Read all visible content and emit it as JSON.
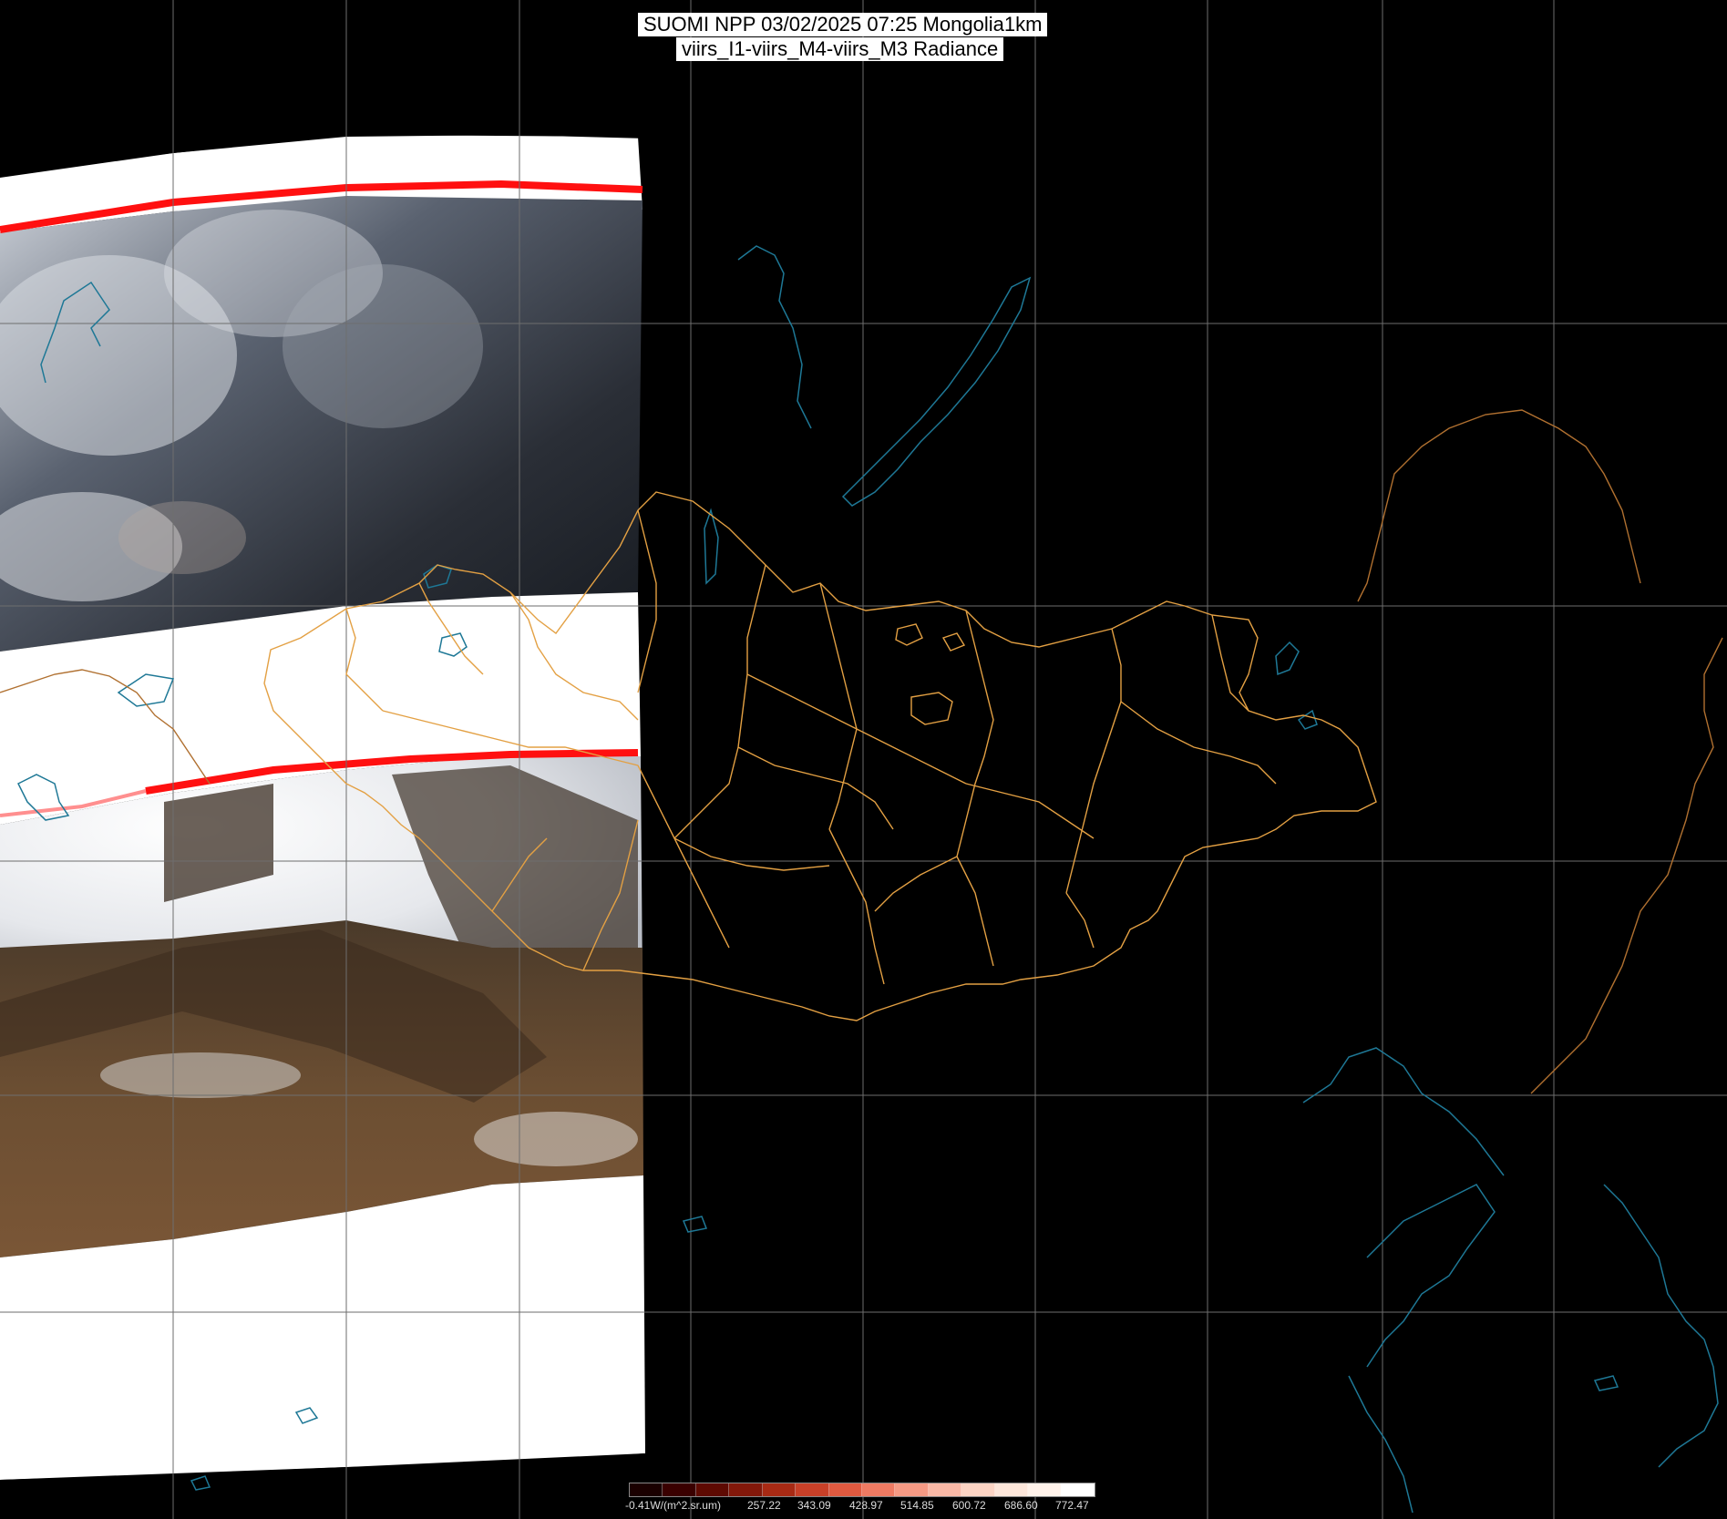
{
  "title": {
    "line1": "SUOMI NPP 03/02/2025 07:25 Mongolia1km",
    "line2": "viirs_I1-viirs_M4-viirs_M3 Radiance"
  },
  "colorbar": {
    "unit_label": "-0.41W/(m^2.sr.um)",
    "tick_labels": [
      "257.22",
      "343.09",
      "428.97",
      "514.85",
      "600.72",
      "686.60",
      "772.47"
    ],
    "colors": [
      "#1a0000",
      "#3a0000",
      "#5e0a02",
      "#82180a",
      "#a82a14",
      "#c84028",
      "#e05a40",
      "#ee7a62",
      "#f59a84",
      "#f9b8a6",
      "#fcd4c4",
      "#fde6da",
      "#fff2ea",
      "#ffffff"
    ]
  },
  "map": {
    "background_color": "#000000",
    "gridline_color": "#6e6e6e",
    "country_border_color": "#c8803a",
    "province_border_color": "#e3a043",
    "coastline_color": "#1e7896",
    "swath_edge_color": "#ff1010"
  }
}
